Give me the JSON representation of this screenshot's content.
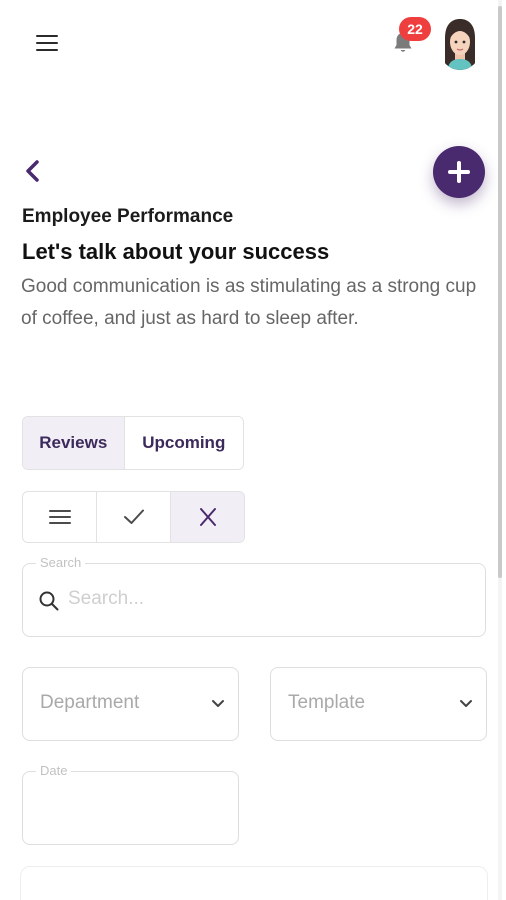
{
  "topbar": {
    "notification_count": "22",
    "icons": [
      "menu-icon",
      "bell-icon",
      "avatar"
    ]
  },
  "header": {
    "eyebrow": "Employee Performance",
    "title": "Let's talk about your success",
    "subtitle": "Good communication is as stimulating as a strong cup of coffee, and just as hard to sleep after."
  },
  "tabs": [
    {
      "label": "Reviews",
      "selected": true
    },
    {
      "label": "Upcoming",
      "selected": false
    }
  ],
  "filters": [
    {
      "icon": "list-icon"
    },
    {
      "icon": "check-icon"
    },
    {
      "icon": "close-icon",
      "selected": true
    }
  ],
  "search": {
    "label": "Search",
    "placeholder": "Search..."
  },
  "department": {
    "placeholder": "Department"
  },
  "template": {
    "placeholder": "Template"
  },
  "date": {
    "label": "Date"
  },
  "colors": {
    "accent": "#4a2a6e",
    "badge": "#ef3e3e",
    "tab_selected_bg": "#f1eff5"
  }
}
